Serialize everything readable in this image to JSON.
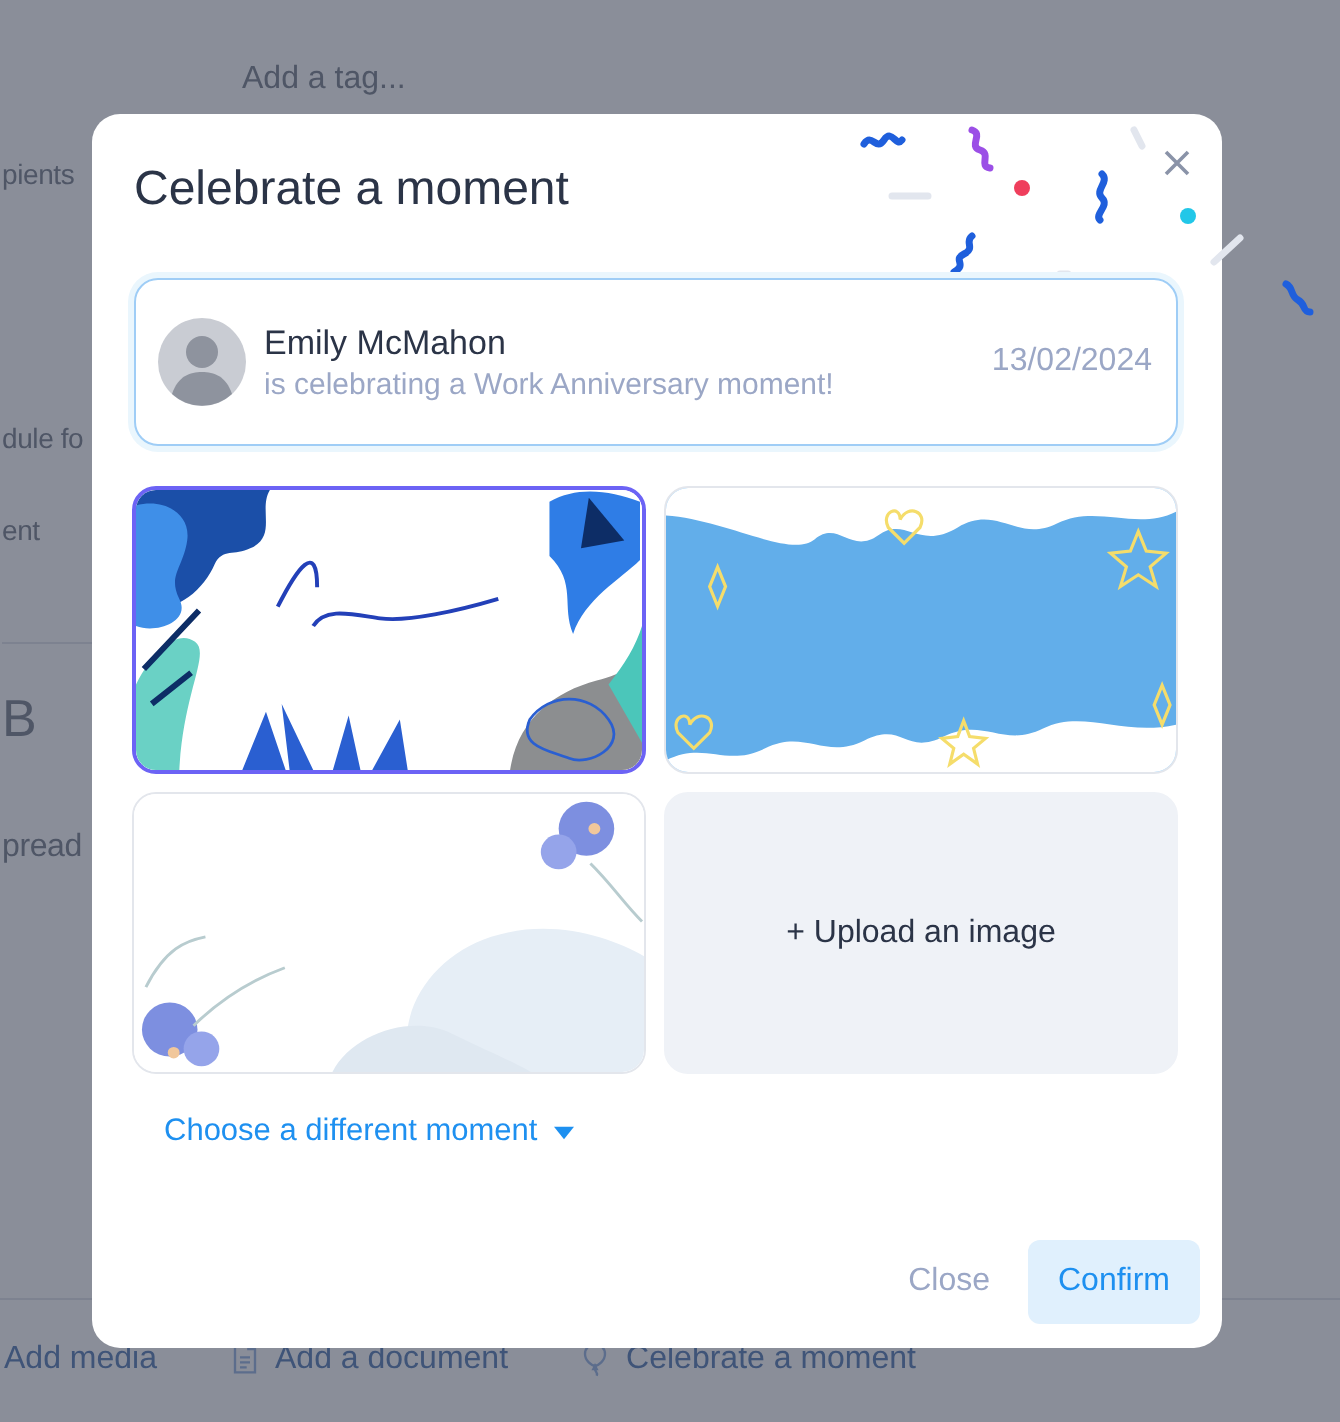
{
  "background": {
    "tag_placeholder": "Add a tag...",
    "fragments": [
      {
        "kind": "text",
        "text": "pients"
      },
      {
        "kind": "text",
        "text": "dule fo"
      },
      {
        "kind": "text",
        "text": "ent"
      },
      {
        "kind": "heading",
        "text": "B"
      },
      {
        "kind": "text",
        "text": "pread"
      }
    ],
    "actions": [
      {
        "kind": "media",
        "label": "Add media"
      },
      {
        "kind": "document",
        "label": "Add a document"
      },
      {
        "kind": "celebrate",
        "label": "Celebrate a moment"
      }
    ]
  },
  "dialog": {
    "title": "Celebrate a moment",
    "celebrant": {
      "name": "Emily McMahon",
      "message": "is celebrating a Work Anniversary moment!",
      "date": "13/02/2024"
    },
    "cards": [
      {
        "kind": "script",
        "selected": true
      },
      {
        "kind": "doodle",
        "selected": false
      },
      {
        "kind": "floral",
        "selected": false
      },
      {
        "kind": "upload",
        "label": "+ Upload an image",
        "selected": false
      }
    ],
    "moment_link": "Choose a different moment",
    "buttons": [
      {
        "kind": "secondary",
        "label": "Close"
      },
      {
        "kind": "primary",
        "label": "Confirm"
      }
    ]
  }
}
